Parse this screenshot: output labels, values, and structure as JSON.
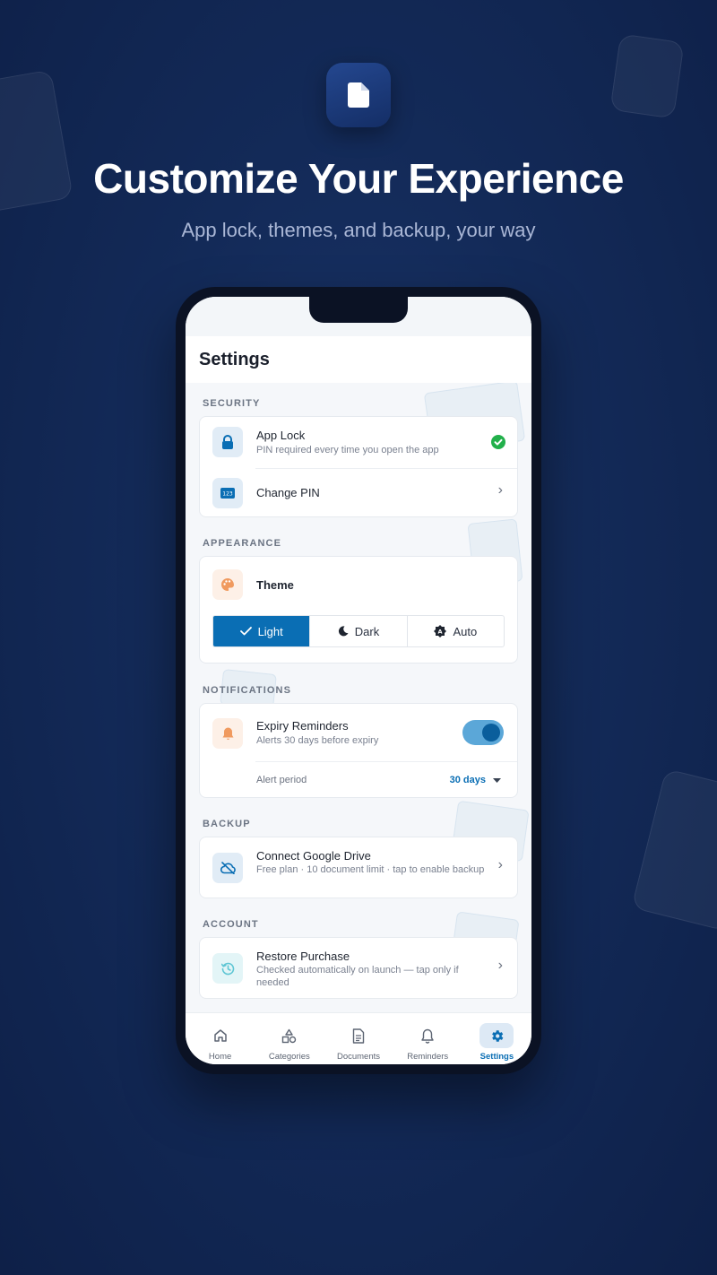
{
  "promo": {
    "headline": "Customize Your Experience",
    "subhead": "App lock, themes, and backup, your way",
    "app_icon": "document-icon"
  },
  "screen": {
    "title": "Settings",
    "sections": {
      "security": {
        "label": "SECURITY",
        "app_lock": {
          "title": "App Lock",
          "subtitle": "PIN required every time you open the app",
          "status_icon": "check-circle-icon",
          "enabled": true
        },
        "change_pin": {
          "title": "Change PIN"
        }
      },
      "appearance": {
        "label": "APPEARANCE",
        "theme": {
          "title": "Theme"
        },
        "options": [
          {
            "label": "Light",
            "icon": "check-icon",
            "selected": true
          },
          {
            "label": "Dark",
            "icon": "moon-icon",
            "selected": false
          },
          {
            "label": "Auto",
            "icon": "auto-brightness-icon",
            "selected": false
          }
        ]
      },
      "notifications": {
        "label": "NOTIFICATIONS",
        "expiry": {
          "title": "Expiry Reminders",
          "subtitle": "Alerts 30 days before expiry",
          "enabled": true
        },
        "alert_period": {
          "label": "Alert period",
          "value": "30 days"
        }
      },
      "backup": {
        "label": "BACKUP",
        "drive": {
          "title": "Connect Google Drive",
          "subtitle": "Free plan · 10 document limit · tap to enable backup"
        }
      },
      "account": {
        "label": "ACCOUNT",
        "restore": {
          "title": "Restore Purchase",
          "subtitle": "Checked automatically on launch — tap only if needed"
        }
      }
    },
    "nav": [
      {
        "label": "Home",
        "icon": "home-icon",
        "active": false
      },
      {
        "label": "Categories",
        "icon": "shapes-icon",
        "active": false
      },
      {
        "label": "Documents",
        "icon": "file-icon",
        "active": false
      },
      {
        "label": "Reminders",
        "icon": "bell-icon",
        "active": false
      },
      {
        "label": "Settings",
        "icon": "gear-icon",
        "active": true
      }
    ]
  },
  "colors": {
    "accent": "#0a6eb4",
    "success": "#22b04b",
    "background": "#132a58"
  }
}
